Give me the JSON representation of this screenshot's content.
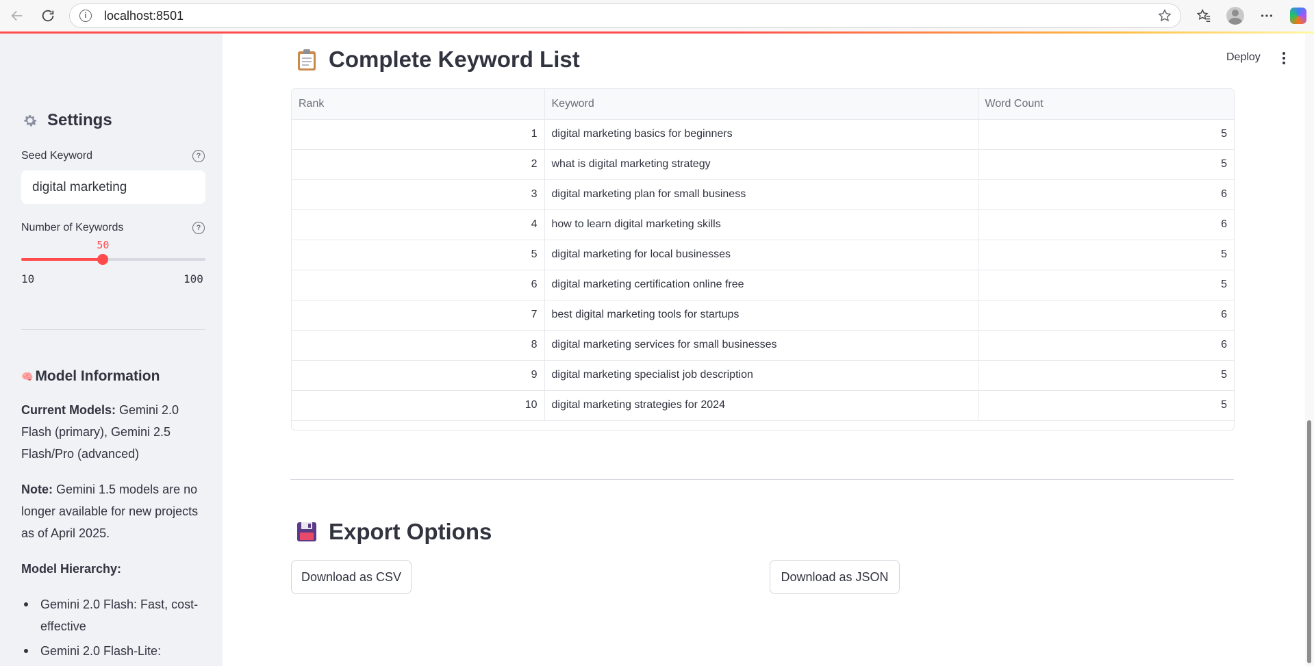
{
  "browser": {
    "url": "localhost:8501"
  },
  "sidebar": {
    "settings_title": "Settings",
    "seed_keyword_label": "Seed Keyword",
    "seed_keyword_value": "digital marketing",
    "num_keywords_label": "Number of Keywords",
    "slider": {
      "value": "50",
      "min": "10",
      "max": "100",
      "fraction": 0.444
    },
    "model_info_title": "Model Information",
    "current_models_label": "Current Models:",
    "current_models_text": "Gemini 2.0 Flash (primary), Gemini 2.5 Flash/Pro (advanced)",
    "note_label": "Note:",
    "note_text": "Gemini 1.5 models are no longer available for new projects as of April 2025.",
    "hierarchy_label": "Model Hierarchy:",
    "hierarchy_items": [
      "Gemini 2.0 Flash: Fast, cost-effective",
      "Gemini 2.0 Flash-Lite:"
    ]
  },
  "header": {
    "deploy_label": "Deploy"
  },
  "main": {
    "keyword_list_title": "Complete Keyword List",
    "export_title": "Export Options",
    "download_csv_label": "Download as CSV",
    "download_json_label": "Download as JSON"
  },
  "table": {
    "headers": [
      "Rank",
      "Keyword",
      "Word Count"
    ],
    "rows": [
      [
        "1",
        "digital marketing basics for beginners",
        "5"
      ],
      [
        "2",
        "what is digital marketing strategy",
        "5"
      ],
      [
        "3",
        "digital marketing plan for small business",
        "6"
      ],
      [
        "4",
        "how to learn digital marketing skills",
        "6"
      ],
      [
        "5",
        "digital marketing for local businesses",
        "5"
      ],
      [
        "6",
        "digital marketing certification online free",
        "5"
      ],
      [
        "7",
        "best digital marketing tools for startups",
        "6"
      ],
      [
        "8",
        "digital marketing services for small businesses",
        "6"
      ],
      [
        "9",
        "digital marketing specialist job description",
        "5"
      ],
      [
        "10",
        "digital marketing strategies for 2024",
        "5"
      ]
    ]
  },
  "colors": {
    "accent": "#ff4b4b",
    "sidebar_bg": "#f0f2f6",
    "text": "#31333f"
  }
}
